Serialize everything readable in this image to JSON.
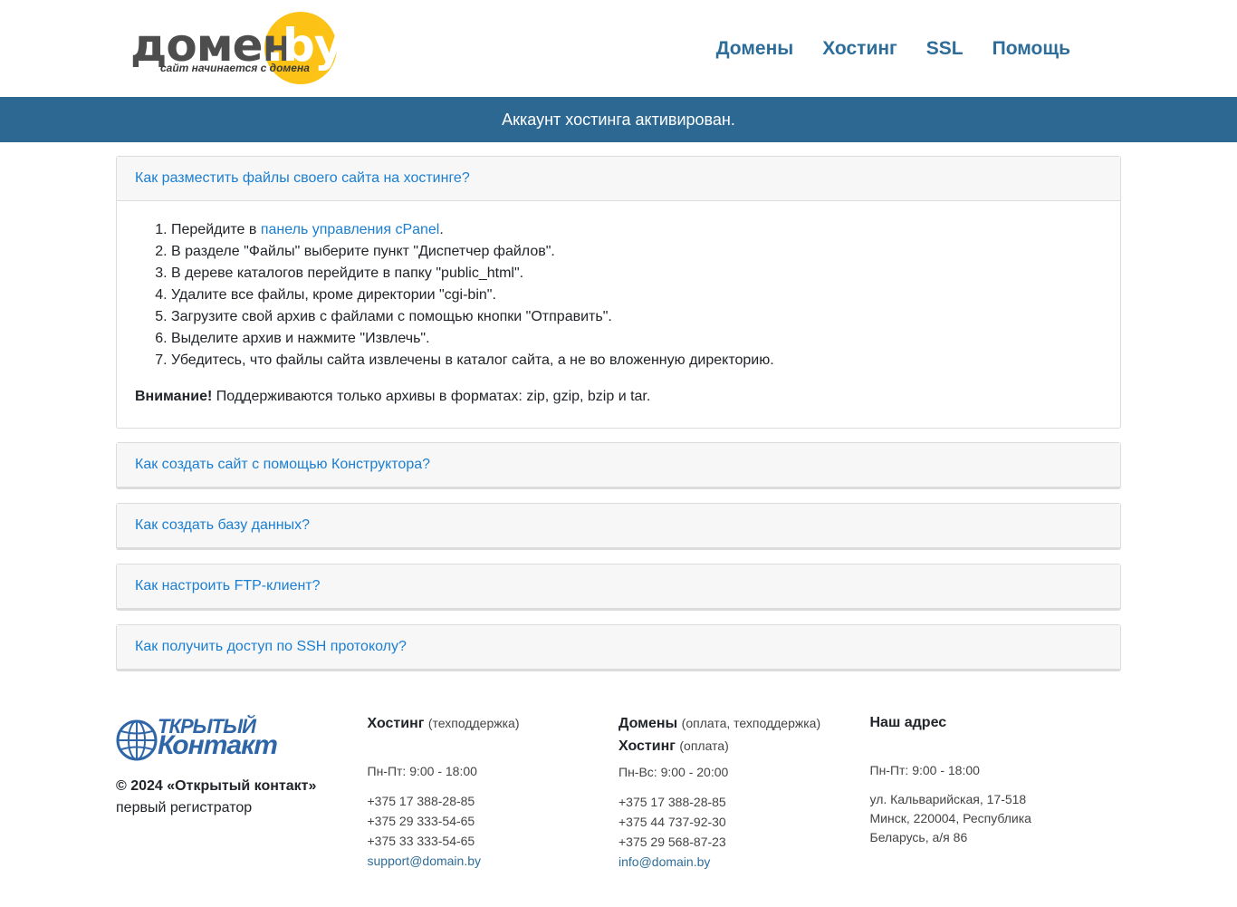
{
  "header": {
    "logo_word": "домен",
    "logo_by": ".by",
    "logo_tagline": "сайт начинается с домена",
    "nav": [
      "Домены",
      "Хостинг",
      "SSL",
      "Помощь"
    ]
  },
  "banner": "Аккаунт хостинга активирован.",
  "accordion": [
    {
      "title": "Как разместить файлы своего сайта на хостинге?",
      "steps": {
        "s1_prefix": "Перейдите в ",
        "s1_link": "панель управления cPanel",
        "s1_suffix": ".",
        "s2": "В разделе \"Файлы\" выберите пункт \"Диспетчер файлов\".",
        "s3": "В дереве каталогов перейдите в папку \"public_html\".",
        "s4": "Удалите все файлы, кроме директории \"cgi-bin\".",
        "s5": "Загрузите свой архив с файлами с помощью кнопки \"Отправить\".",
        "s6": "Выделите архив и нажмите \"Извлечь\".",
        "s7": "Убедитесь, что файлы сайта извлечены в каталог сайта, а не во вложенную директорию."
      },
      "warning_label": "Внимание!",
      "warning_text": " Поддерживаются только архивы в форматах: zip, gzip, bzip и tar."
    },
    {
      "title": "Как создать сайт с помощью Конструктора?"
    },
    {
      "title": "Как создать базу данных?"
    },
    {
      "title": "Как настроить FTP-клиент?"
    },
    {
      "title": "Как получить доступ по SSH протоколу?"
    }
  ],
  "footer": {
    "logo_line1": "ТКРЫТЫЙ",
    "logo_line2": "Контакт",
    "copyright": "© 2024 «Открытый контакт»",
    "copyright_sub": "первый регистратор",
    "hosting": {
      "title": "Хостинг",
      "note": "(техподдержка)",
      "hours": "Пн-Пт: 9:00 - 18:00",
      "phones": [
        "+375 17 388-28-85",
        "+375 29 333-54-65",
        "+375 33 333-54-65"
      ],
      "email": "support@domain.by"
    },
    "domains": {
      "title": "Домены",
      "note": "(оплата, техподдержка)",
      "title2": "Хостинг",
      "note2": "(оплата)",
      "hours": "Пн-Вс: 9:00 - 20:00",
      "phones": [
        "+375 17 388-28-85",
        "+375 44 737-92-30",
        "+375 29 568-87-23"
      ],
      "email": "info@domain.by"
    },
    "address": {
      "title": "Наш адрес",
      "hours": "Пн-Пт: 9:00 - 18:00",
      "lines": [
        "ул. Кальварийская, 17-518",
        "Минск, 220004, Республика",
        "Беларусь, а/я 86"
      ]
    }
  }
}
